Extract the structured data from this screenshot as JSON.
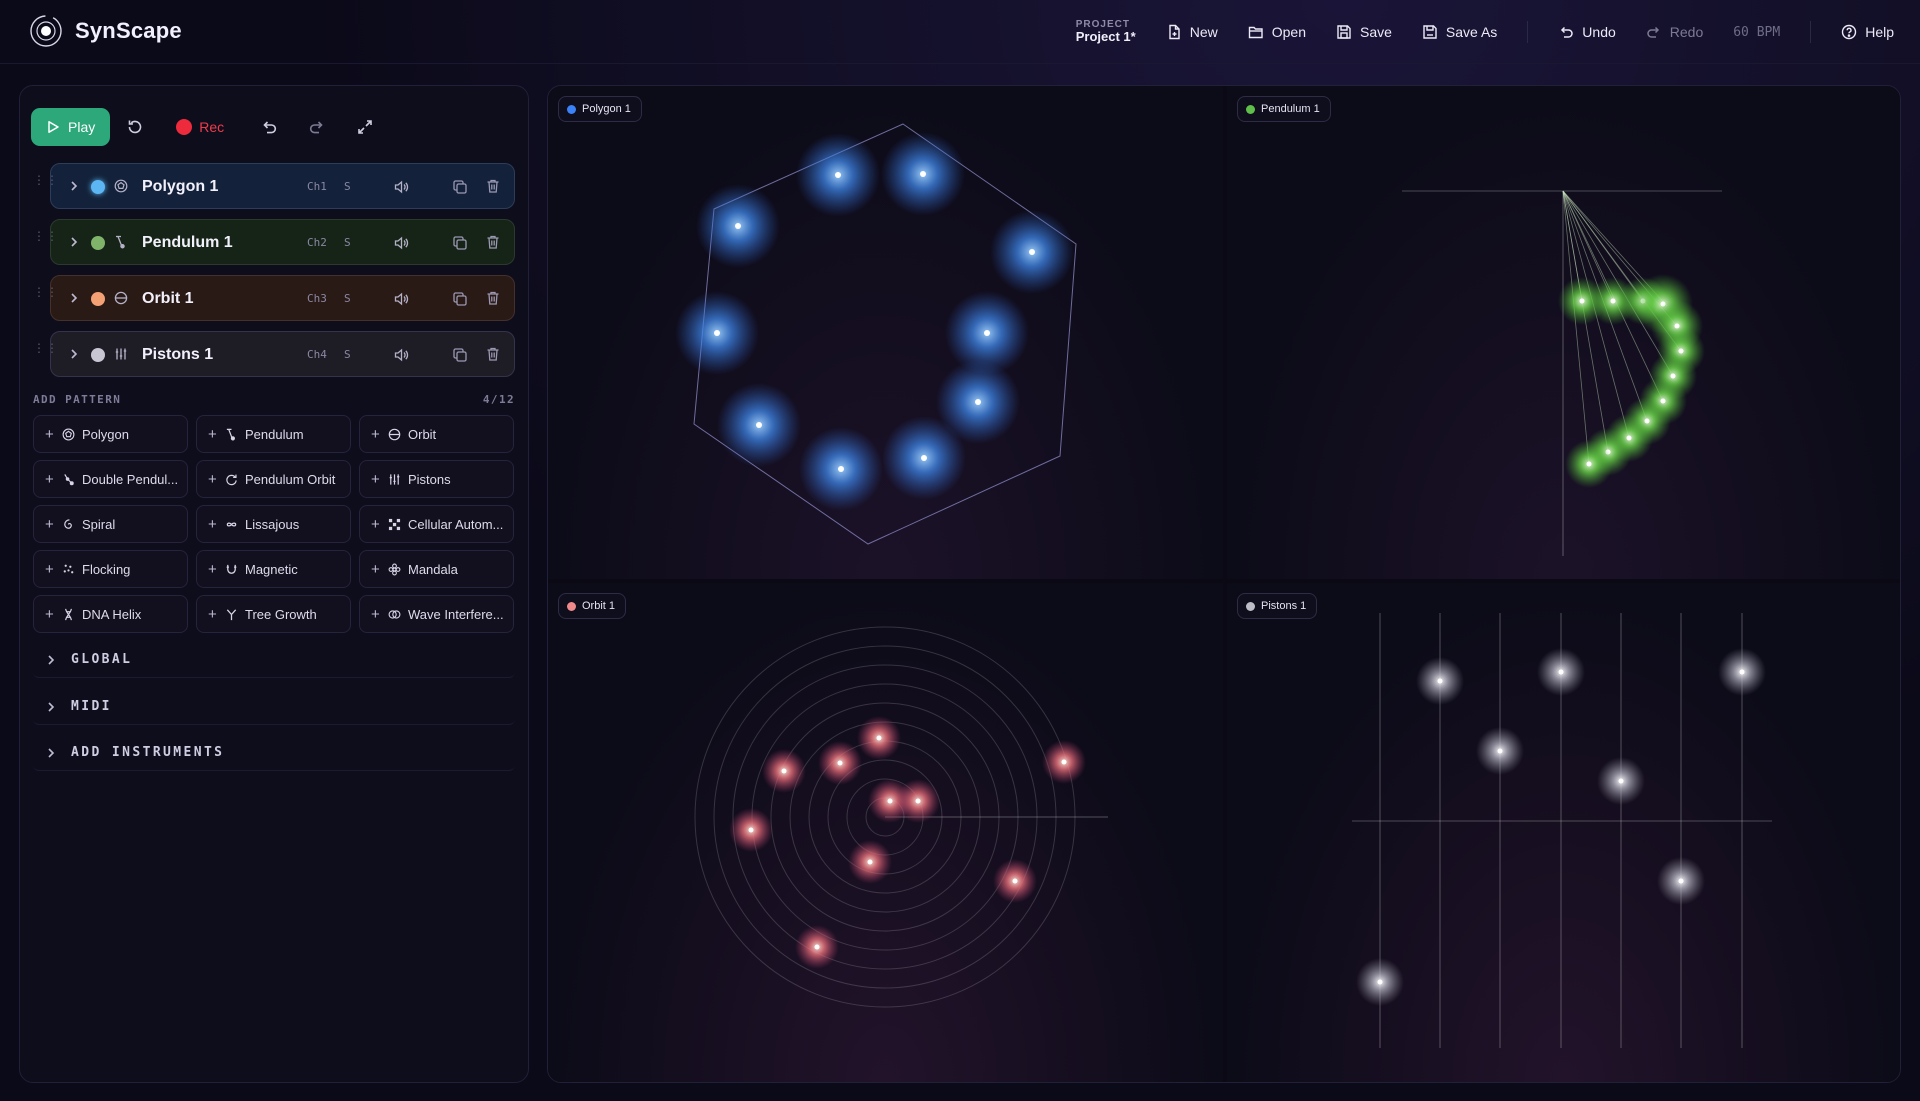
{
  "app": {
    "name": "SynScape",
    "logo_icon": "synscape-logo-icon"
  },
  "header": {
    "project_label": "PROJECT",
    "project_name": "Project 1*",
    "actions": [
      {
        "label": "New",
        "icon": "new-file-icon"
      },
      {
        "label": "Open",
        "icon": "folder-open-icon"
      },
      {
        "label": "Save",
        "icon": "save-icon"
      },
      {
        "label": "Save As",
        "icon": "save-as-icon"
      },
      {
        "label": "Undo",
        "icon": "undo-icon"
      },
      {
        "label": "Redo",
        "icon": "redo-icon",
        "disabled": true
      }
    ],
    "bpm": "60 BPM",
    "help": "Help"
  },
  "transport": {
    "play": "Play",
    "rec": "Rec"
  },
  "tracks": [
    {
      "name": "Polygon 1",
      "channel": "Ch1",
      "solo": "S",
      "color": "#5bb6f2",
      "icon": "polygon-icon",
      "tint": "#13223a"
    },
    {
      "name": "Pendulum 1",
      "channel": "Ch2",
      "solo": "S",
      "color": "#7fb36a",
      "icon": "pendulum-icon",
      "tint": "#162418"
    },
    {
      "name": "Orbit 1",
      "channel": "Ch3",
      "solo": "S",
      "color": "#f2a074",
      "icon": "orbit-icon",
      "tint": "#2a1a16"
    },
    {
      "name": "Pistons 1",
      "channel": "Ch4",
      "solo": "S",
      "color": "#c8c6d2",
      "icon": "pistons-icon",
      "tint": "#1e1d26"
    }
  ],
  "add_pattern": {
    "title": "ADD PATTERN",
    "count": "4/12",
    "buttons": [
      {
        "label": "Polygon",
        "icon": "polygon-icon"
      },
      {
        "label": "Pendulum",
        "icon": "pendulum-icon"
      },
      {
        "label": "Orbit",
        "icon": "orbit-icon"
      },
      {
        "label": "Double Pendul...",
        "icon": "double-pendulum-icon"
      },
      {
        "label": "Pendulum Orbit",
        "icon": "pendulum-orbit-icon"
      },
      {
        "label": "Pistons",
        "icon": "pistons-icon"
      },
      {
        "label": "Spiral",
        "icon": "spiral-icon"
      },
      {
        "label": "Lissajous",
        "icon": "infinity-icon"
      },
      {
        "label": "Cellular Autom...",
        "icon": "grid-cells-icon"
      },
      {
        "label": "Flocking",
        "icon": "flocking-icon"
      },
      {
        "label": "Magnetic",
        "icon": "magnet-icon"
      },
      {
        "label": "Mandala",
        "icon": "mandala-icon"
      },
      {
        "label": "DNA Helix",
        "icon": "dna-icon"
      },
      {
        "label": "Tree Growth",
        "icon": "tree-icon"
      },
      {
        "label": "Wave Interfere...",
        "icon": "wave-icon"
      }
    ]
  },
  "sections": [
    "GLOBAL",
    "MIDI",
    "ADD INSTRUMENTS"
  ],
  "visualizers": {
    "polygon": {
      "label": "Polygon 1",
      "color": "#3b82f6"
    },
    "pendulum": {
      "label": "Pendulum 1",
      "color": "#5fbf4a"
    },
    "orbit": {
      "label": "Orbit 1",
      "color": "#f08a8a"
    },
    "pistons": {
      "label": "Pistons 1",
      "color": "#bdbdc8"
    }
  }
}
